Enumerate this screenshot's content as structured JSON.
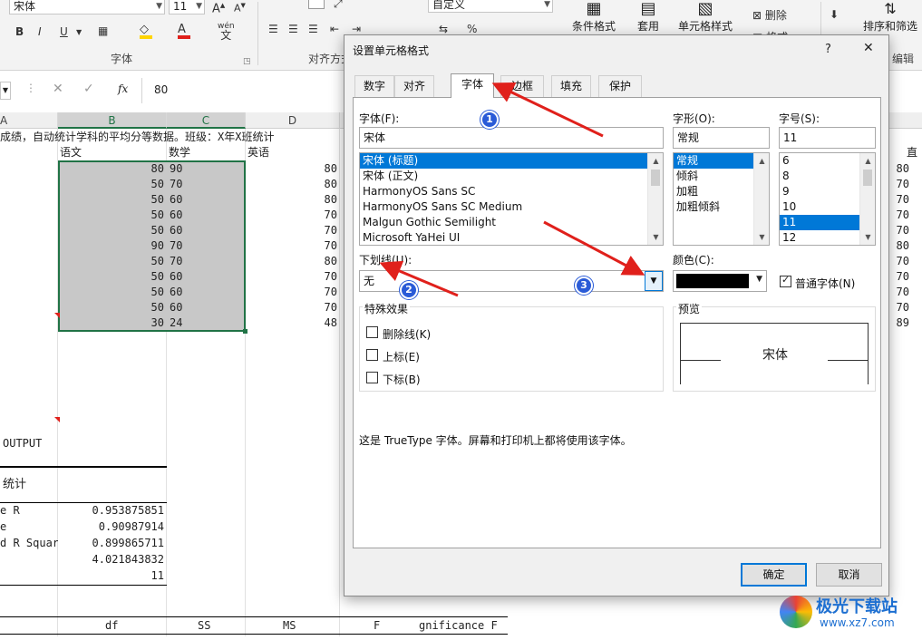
{
  "ribbon": {
    "font_name": "宋体",
    "font_size": "11",
    "number_format": "自定义",
    "group_font": "字体",
    "group_align": "对齐方式",
    "group_edit": "编辑",
    "btn_conditional": "条件格式",
    "btn_table": "套用",
    "btn_cellstyle": "单元格样式",
    "btn_delete": "删除",
    "btn_format": "格式",
    "btn_sort": "排序和筛选",
    "wen": "wén",
    "percent": "%"
  },
  "formula": {
    "value": "80",
    "fx": "fx"
  },
  "columns": {
    "a": "A",
    "b": "B",
    "c": "C",
    "d": "D"
  },
  "sheet": {
    "title_row": "成绩，自动统计学科的平均分等数据。班级：X年X班统计",
    "headers": [
      "语文",
      "数学",
      "英语"
    ],
    "rows": [
      {
        "b": "80",
        "c": "90",
        "d": "80",
        "right": "80"
      },
      {
        "b": "50",
        "c": "70",
        "d": "80",
        "right": "70"
      },
      {
        "b": "50",
        "c": "60",
        "d": "80",
        "right": "70"
      },
      {
        "b": "50",
        "c": "60",
        "d": "70",
        "right": "70"
      },
      {
        "b": "50",
        "c": "60",
        "d": "70",
        "right": "70"
      },
      {
        "b": "90",
        "c": "70",
        "d": "70",
        "right": "80"
      },
      {
        "b": "50",
        "c": "70",
        "d": "80",
        "right": "70"
      },
      {
        "b": "50",
        "c": "60",
        "d": "70",
        "right": "70"
      },
      {
        "b": "50",
        "c": "60",
        "d": "70",
        "right": "70"
      },
      {
        "b": "50",
        "c": "60",
        "d": "70",
        "right": "70"
      },
      {
        "b": "30",
        "c": "24",
        "d": "48",
        "right": "89"
      }
    ],
    "output_label": "OUTPUT",
    "stats_label": "统计",
    "stats": [
      {
        "label": "e R",
        "value": "0.953875851"
      },
      {
        "label": "e",
        "value": "0.90987914"
      },
      {
        "label": "d R Squar",
        "value": "0.899865711"
      },
      {
        "label": "",
        "value": "4.021843832"
      },
      {
        "label": "",
        "value": "11"
      }
    ],
    "anova_headers": [
      "df",
      "SS",
      "MS",
      "F",
      "gnificance F"
    ],
    "right_header": "直"
  },
  "dialog": {
    "title": "设置单元格格式",
    "help": "?",
    "close": "✕",
    "tabs": [
      "数字",
      "对齐",
      "字体",
      "边框",
      "填充",
      "保护"
    ],
    "active_tab": 2,
    "font_label": "字体(F):",
    "font_value": "宋体",
    "font_list": [
      "宋体 (标题)",
      "宋体 (正文)",
      "HarmonyOS Sans SC",
      "HarmonyOS Sans SC Medium",
      "Malgun Gothic Semilight",
      "Microsoft YaHei UI"
    ],
    "style_label": "字形(O):",
    "style_value": "常规",
    "style_list": [
      "常规",
      "倾斜",
      "加粗",
      "加粗倾斜"
    ],
    "size_label": "字号(S):",
    "size_value": "11",
    "size_list": [
      "6",
      "8",
      "9",
      "10",
      "11",
      "12"
    ],
    "underline_label": "下划线(U):",
    "underline_value": "无",
    "color_label": "颜色(C):",
    "normal_font_label": "普通字体(N)",
    "effects_label": "特殊效果",
    "strike_label": "删除线(K)",
    "super_label": "上标(E)",
    "sub_label": "下标(B)",
    "preview_label": "预览",
    "preview_text": "宋体",
    "info_text": "这是 TrueType 字体。屏幕和打印机上都将使用该字体。",
    "ok": "确定",
    "cancel": "取消"
  },
  "annotations": {
    "badge1": "1",
    "badge2": "2",
    "badge3": "3"
  },
  "watermark": {
    "text": "极光下载站",
    "url": "www.xz7.com"
  },
  "colors": {
    "selection": "#0078d7",
    "arrow": "#e0201b",
    "badge": "#2a5bd7",
    "cell_fill": "#c8c8c8",
    "excel_green": "#217346"
  }
}
